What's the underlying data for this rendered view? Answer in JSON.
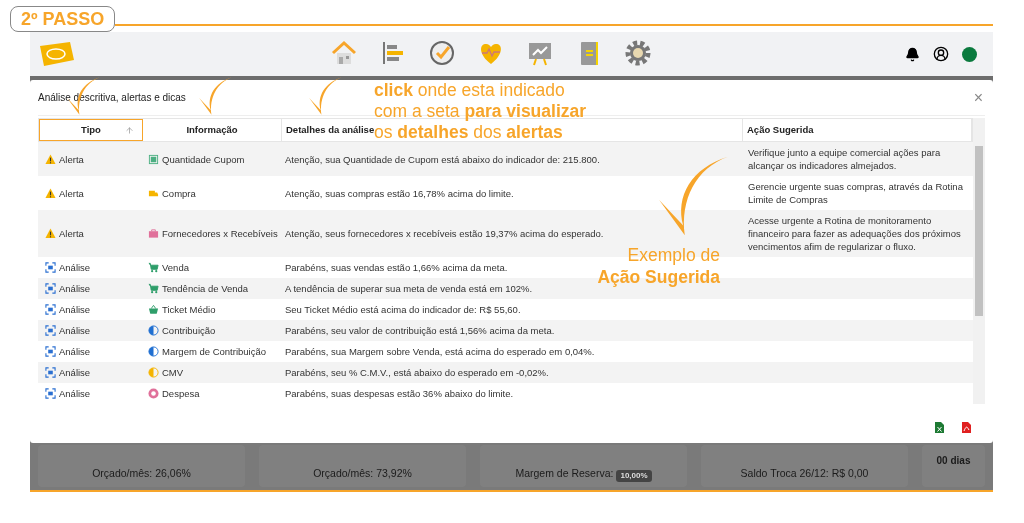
{
  "step_badge": "2º PASSO",
  "nav": {
    "items": [
      {
        "selected": false
      },
      {
        "selected": false
      },
      {
        "selected": false
      },
      {
        "selected": false
      },
      {
        "selected": false
      },
      {
        "selected": false
      },
      {
        "selected": false
      }
    ]
  },
  "modal": {
    "title": "Análise descritiva, alertas e dicas",
    "close": "×",
    "columns": [
      {
        "label": "Tipo",
        "selected": true
      },
      {
        "label": "Informação",
        "selected": false
      },
      {
        "label": "Detalhes da análise",
        "selected": false
      },
      {
        "label": "Ação Sugerida",
        "selected": false
      }
    ],
    "rows": [
      {
        "kind": "alert",
        "type": "Alerta",
        "info": "Quantidade Cupom",
        "color": "#4caf82",
        "details": "Atenção, sua Quantidade de Cupom está abaixo do indicador de: 215.800.",
        "action": "Verifique junto a equipe comercial ações para alcançar os indicadores almejados."
      },
      {
        "kind": "alert",
        "type": "Alerta",
        "info": "Compra",
        "color": "#f5b400",
        "details": "Atenção, suas compras estão 16,78% acima do limite.",
        "action": "Gerencie urgente suas compras, através da Rotina Limite de Compras"
      },
      {
        "kind": "alert",
        "type": "Alerta",
        "info": "Fornecedores x Recebíveis",
        "color": "#e0709a",
        "details": "Atenção, seus fornecedores x recebíveis estão 19,37% acima do esperado.",
        "action": "Acesse urgente a Rotina de monitoramento financeiro para fazer as adequações dos próximos vencimentos afim de regularizar o fluxo."
      },
      {
        "kind": "analysis",
        "type": "Análise",
        "info": "Venda",
        "color": "#2e9e6a",
        "details": "Parabéns, suas vendas estão 1,66% acima da meta."
      },
      {
        "kind": "analysis",
        "type": "Análise",
        "info": "Tendência de Venda",
        "color": "#2e9e6a",
        "details": "A tendência de superar sua meta de venda está em 102%."
      },
      {
        "kind": "analysis",
        "type": "Análise",
        "info": "Ticket Médio",
        "color": "#2e9e6a",
        "details": "Seu Ticket Médio está acima do indicador de: R$ 55,60."
      },
      {
        "kind": "analysis",
        "type": "Análise",
        "info": "Contribuição",
        "color": "#1f6fd1",
        "details": "Parabéns, seu valor de contribuição está 1,56% acima da meta."
      },
      {
        "kind": "analysis",
        "type": "Análise",
        "info": "Margem de Contribuição",
        "color": "#1f6fd1",
        "details": "Parabéns, sua Margem sobre Venda, está acima do esperado em 0,04%."
      },
      {
        "kind": "analysis",
        "type": "Análise",
        "info": "CMV",
        "color": "#f5b400",
        "details": "Parabéns, seu % C.M.V., está abaixo do esperado em -0,02%."
      },
      {
        "kind": "analysis",
        "type": "Análise",
        "info": "Despesa",
        "color": "#e0709a",
        "details": "Parabéns, suas despesas estão 36% abaixo do limite."
      }
    ]
  },
  "callouts": [
    {
      "lines": [
        "**click** onde esta indicado",
        "com a seta **para visualizar**",
        "os **detalhes** dos **alertas**"
      ]
    },
    {
      "lines": [
        "Exemplo de",
        "**Ação Sugerida**"
      ]
    }
  ],
  "cards": [
    {
      "text": "Orçado/mês: 26,06%"
    },
    {
      "text": "Orçado/mês: 73,92%"
    },
    {
      "text": "Margem de Reserva:",
      "badge": "10,00%"
    },
    {
      "text": "Saldo Troca 26/12: R$ 0,00"
    },
    {
      "text": "00 dias"
    }
  ]
}
